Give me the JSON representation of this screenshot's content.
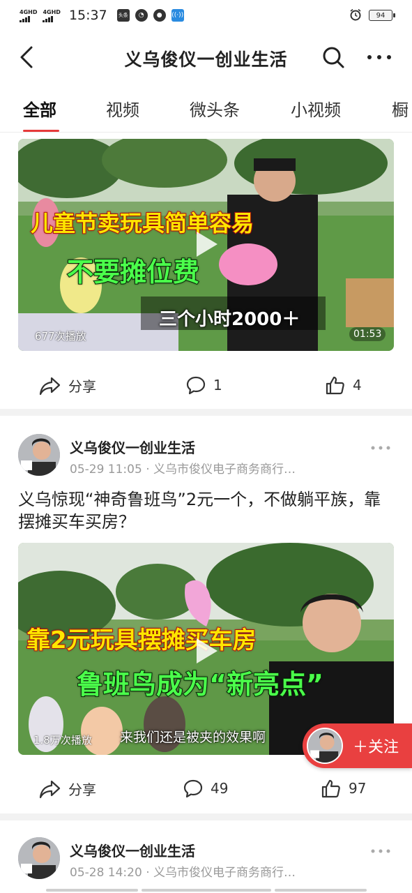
{
  "status_bar": {
    "network1": "4GHD",
    "network2": "4GHD",
    "time": "15:37",
    "app_badge": "头条",
    "battery": "94"
  },
  "header": {
    "title": "义乌俊仪一创业生活"
  },
  "tabs": [
    {
      "label": "全部",
      "active": true
    },
    {
      "label": "视频",
      "active": false
    },
    {
      "label": "微头条",
      "active": false
    },
    {
      "label": "小视频",
      "active": false
    },
    {
      "label": "橱",
      "active": false
    }
  ],
  "posts": [
    {
      "video": {
        "caption_top": "儿童节卖玩具简单容易",
        "caption_mid": "不要摊位费",
        "caption_bottom": "三个小时2000＋",
        "play_count": "677次播放",
        "duration": "01:53"
      },
      "actions": {
        "share": "分享",
        "comments": "1",
        "likes": "4"
      }
    },
    {
      "author": "义乌俊仪一创业生活",
      "meta": "05-29 11:05 · 义乌市俊仪电子商务商行…",
      "title": "义乌惊现“神奇鲁班鸟”2元一个，不做躺平族，靠摆摊买车买房？",
      "video": {
        "caption_top": "靠2元玩具摆摊买车房",
        "caption_mid": "鲁班鸟成为“新亮点”",
        "subtitle": "来我们还是被夹的效果啊",
        "play_count": "1.8万次播放"
      },
      "actions": {
        "share": "分享",
        "comments": "49",
        "likes": "97"
      }
    },
    {
      "author": "义乌俊仪一创业生活",
      "meta": "05-28 14:20 · 义乌市俊仪电子商务商行…"
    }
  ],
  "follow_button": {
    "label": "＋关注"
  },
  "colors": {
    "accent": "#e94040",
    "tab_underline": "#e63a3a",
    "meta_gray": "#999999"
  }
}
